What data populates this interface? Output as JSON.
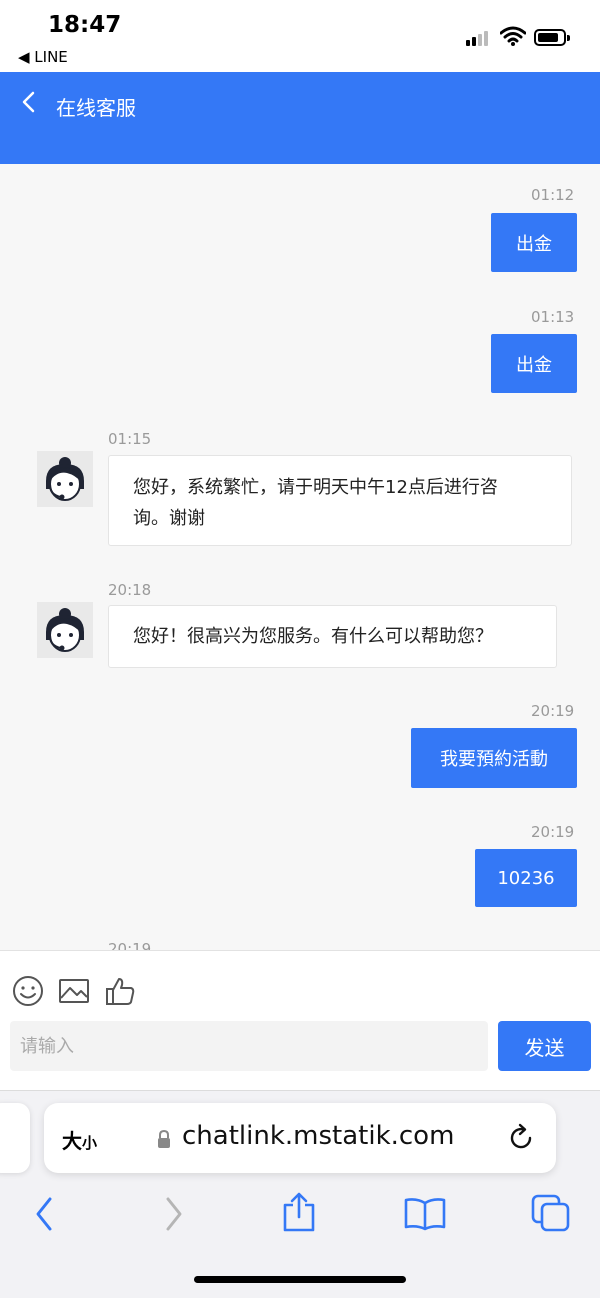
{
  "status_bar": {
    "time": "18:47",
    "back_app": "◀ LINE"
  },
  "header": {
    "title": "在线客服"
  },
  "messages": [
    {
      "dir": "out",
      "time": "01:12",
      "text": "出金"
    },
    {
      "dir": "out",
      "time": "01:13",
      "text": "出金"
    },
    {
      "dir": "in",
      "time": "01:15",
      "text_line1": "您好，系统繁忙，请于明天中午12点后进行咨",
      "text_line2": "询。谢谢"
    },
    {
      "dir": "in",
      "time": "20:18",
      "text": "您好！很高兴为您服务。有什么可以帮助您？"
    },
    {
      "dir": "out",
      "time": "20:19",
      "text": "我要預約活動"
    },
    {
      "dir": "out",
      "time": "20:19",
      "text": "10236"
    },
    {
      "dir": "partial",
      "time": "20:19"
    }
  ],
  "toolbar": {
    "icons": [
      "smiley-icon",
      "image-icon",
      "thumbs-up-icon"
    ]
  },
  "composer": {
    "placeholder": "请输入",
    "send_label": "发送"
  },
  "browser": {
    "text_size": "大",
    "text_size_small": "小",
    "url": "chatlink.mstatik.com"
  },
  "colors": {
    "accent": "#3478f6",
    "background": "#f7f7f7"
  }
}
